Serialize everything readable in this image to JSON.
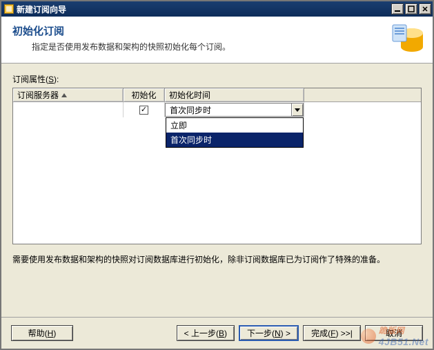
{
  "window": {
    "title": "新建订阅向导"
  },
  "header": {
    "title": "初始化订阅",
    "subtitle": "指定是否使用发布数据和架构的快照初始化每个订阅。"
  },
  "props_label_prefix": "订阅属性(",
  "props_label_key": "S",
  "props_label_suffix": "):",
  "grid": {
    "columns": {
      "server": "订阅服务器",
      "init": "初始化",
      "init_time": "初始化时间"
    },
    "row": {
      "server": " ",
      "init_checked": "✓",
      "init_time_selected": "首次同步时"
    },
    "dropdown": {
      "opt0": "立即",
      "opt1": "首次同步时"
    }
  },
  "note": "需要使用发布数据和架构的快照对订阅数据库进行初始化，除非订阅数据库已为订阅作了特殊的准备。",
  "buttons": {
    "help": "帮助",
    "help_key": "H",
    "back_prefix": "< 上一步(",
    "back_key": "B",
    "back_suffix": ")",
    "next_prefix": "下一步(",
    "next_key": "N",
    "next_suffix": ") >",
    "finish_prefix": "完成(",
    "finish_key": "F",
    "finish_suffix": ") >>|",
    "cancel": "取消"
  },
  "watermark": {
    "cn": "跪版网",
    "en": "4JB51.Net"
  }
}
